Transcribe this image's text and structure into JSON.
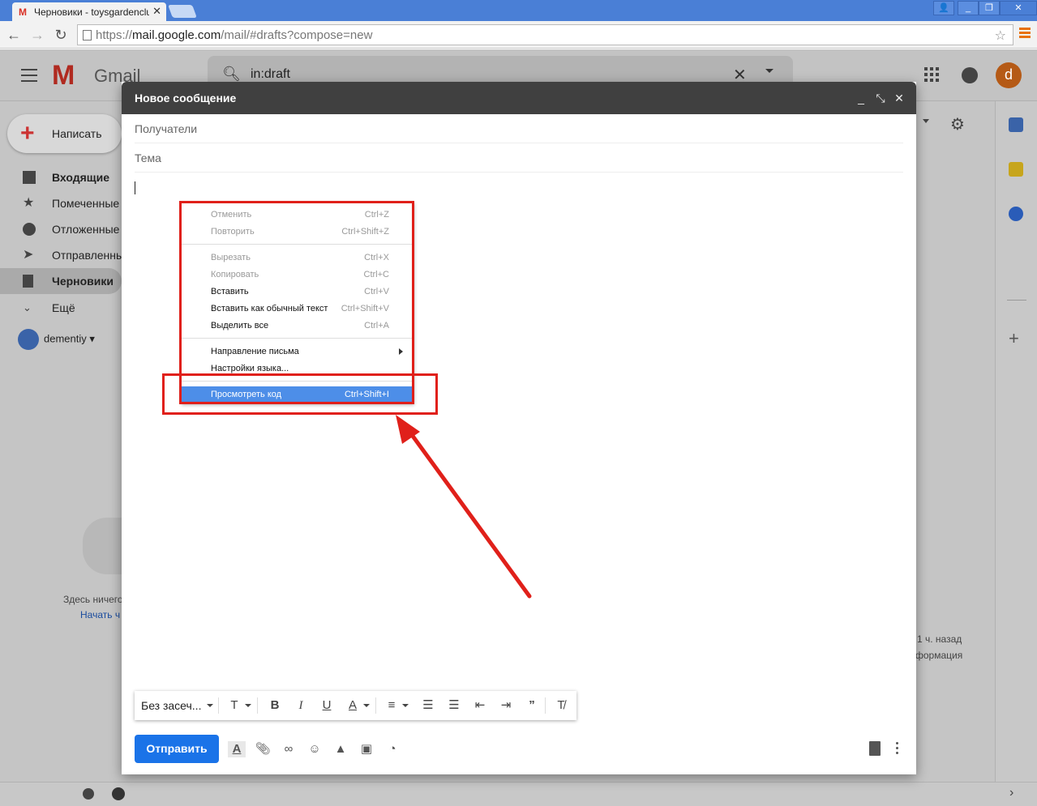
{
  "browser": {
    "tab_title": "Черновики - toysgardenclub",
    "tab_favicon": "M",
    "tab_close": "✕",
    "url_prefix": "https://",
    "url_host": "mail.google.com",
    "url_path": "/mail/#drafts?compose=new",
    "window_buttons": [
      "👤",
      "_",
      "❐",
      "✕"
    ]
  },
  "gmail": {
    "logo_text": "Gmail",
    "search_value": "in:draft",
    "avatar_letter": "d",
    "compose_label": "Написать",
    "sidebar": [
      {
        "label": "Входящие",
        "icon": "inbox-icon",
        "bold": true
      },
      {
        "label": "Помеченные",
        "icon": "star-icon",
        "bold": false
      },
      {
        "label": "Отложенные",
        "icon": "clock-icon",
        "bold": false
      },
      {
        "label": "Отправленные",
        "icon": "send-icon",
        "bold": false
      },
      {
        "label": "Черновики",
        "icon": "draft-icon",
        "bold": true,
        "active": true
      },
      {
        "label": "Ещё",
        "icon": "chevron-down-icon",
        "bold": false
      }
    ],
    "user_name": "dementiy",
    "empty_text": "Здесь ничего",
    "empty_link": "Начать ч",
    "right_time": "1 ч. назад",
    "right_info": "формация"
  },
  "compose": {
    "title": "Новое сообщение",
    "recipients_placeholder": "Получатели",
    "subject_placeholder": "Тема",
    "font_name": "Без засеч...",
    "send_label": "Отправить"
  },
  "context_menu": {
    "items": [
      {
        "label": "Отменить",
        "shortcut": "Ctrl+Z",
        "state": "disabled"
      },
      {
        "label": "Повторить",
        "shortcut": "Ctrl+Shift+Z",
        "state": "disabled"
      },
      {
        "label": "Вырезать",
        "shortcut": "Ctrl+X",
        "state": "disabled"
      },
      {
        "label": "Копировать",
        "shortcut": "Ctrl+C",
        "state": "disabled"
      },
      {
        "label": "Вставить",
        "shortcut": "Ctrl+V",
        "state": "enabled"
      },
      {
        "label": "Вставить как обычный текст",
        "shortcut": "Ctrl+Shift+V",
        "state": "enabled"
      },
      {
        "label": "Выделить все",
        "shortcut": "Ctrl+A",
        "state": "enabled"
      },
      {
        "label": "Направление письма",
        "shortcut": "",
        "state": "enabled",
        "submenu": true
      },
      {
        "label": "Настройки языка...",
        "shortcut": "",
        "state": "enabled"
      },
      {
        "label": "Просмотреть код",
        "shortcut": "Ctrl+Shift+I",
        "state": "highlighted"
      }
    ]
  },
  "colors": {
    "accent": "#1a73e8",
    "annotation": "#e0201a",
    "menu_highlight": "#4d8ee8",
    "compose_header": "#404040"
  }
}
